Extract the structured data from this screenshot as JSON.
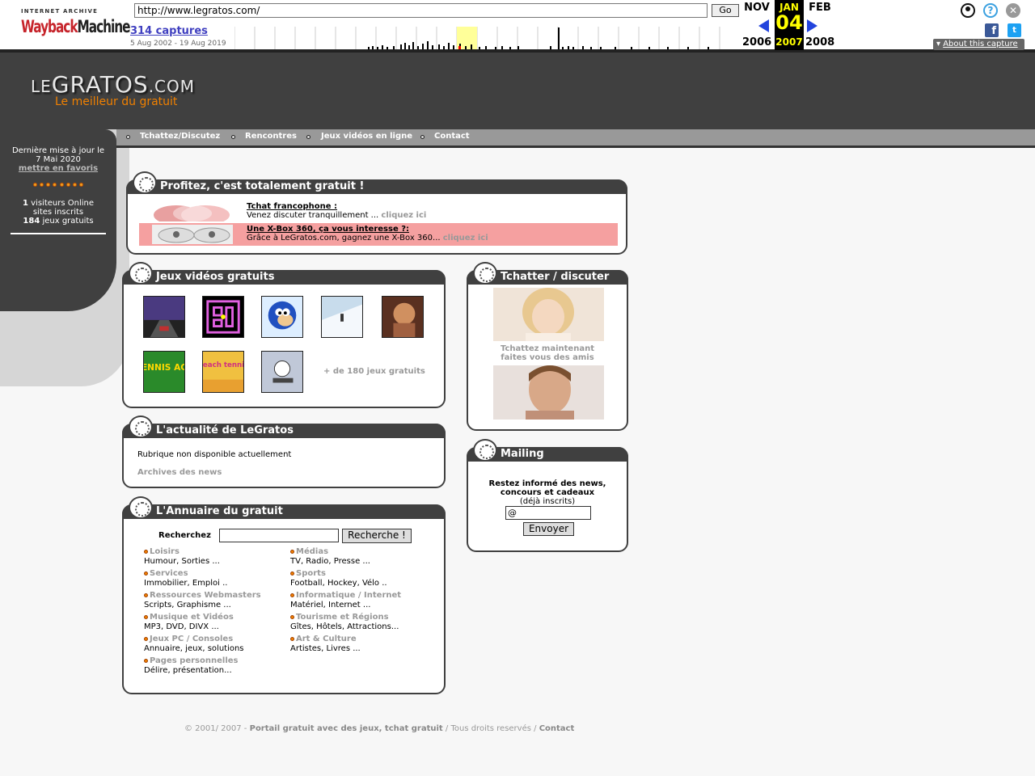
{
  "wayback": {
    "logo_top": "INTERNET ARCHIVE",
    "logo_wayback": "Wayback",
    "logo_machine": "Machine",
    "url": "http://www.legratos.com/",
    "go": "Go",
    "captures": "314 captures",
    "range": "5 Aug 2002 - 19 Aug 2019",
    "prev_month": "NOV",
    "prev_year": "2006",
    "cur_month": "JAN",
    "cur_day": "04",
    "cur_year": "2007",
    "next_month": "FEB",
    "next_year": "2008",
    "about": "About this capture",
    "icons": [
      "user-icon",
      "help-icon",
      "close-icon",
      "facebook-icon",
      "twitter-icon"
    ]
  },
  "site": {
    "logo_le": "LE",
    "logo_gratos": "GRATOS",
    "logo_com": ".COM",
    "tagline": "Le meilleur du gratuit",
    "nav": [
      "Tchattez/Discutez",
      "Rencontres",
      "Jeux vidéos en ligne",
      "Contact"
    ],
    "sidebar": {
      "update_line1": "Dernière mise à jour le",
      "update_date": "7 Mai 2020",
      "favorites": "mettre en favoris",
      "visitors_count": "1",
      "visitors_label": "visiteurs Online",
      "sites_label": "sites inscrits",
      "games_count": "184",
      "games_label": "jeux gratuits"
    },
    "promo": {
      "title": "Profitez, c'est totalement gratuit !",
      "item1_title": "Tchat francophone :",
      "item1_text": "Venez discuter tranquillement ...",
      "item1_link": "cliquez ici",
      "item2_title": "Une X-Box 360, ça vous interesse ?:",
      "item2_text": "Grâce à LeGratos.com, gagnez une X-Box 360...",
      "item2_link": "cliquez ici"
    },
    "games": {
      "title": "Jeux vidéos gratuits",
      "more": "+ de 180 jeux gratuits",
      "thumb_tennis": "TENNIS ACE",
      "thumb_beach": "beach tennis"
    },
    "news": {
      "title": "L'actualité de LeGratos",
      "text": "Rubrique non disponible actuellement",
      "archives": "Archives des news"
    },
    "directory": {
      "title": "L'Annuaire du gratuit",
      "search_label": "Recherchez",
      "search_button": "Recherche !",
      "categories": [
        {
          "name": "Loisirs",
          "desc": "Humour, Sorties ..."
        },
        {
          "name": "Médias",
          "desc": "TV, Radio, Presse ..."
        },
        {
          "name": "Services",
          "desc": "Immobilier, Emploi .."
        },
        {
          "name": "Sports",
          "desc": "Football, Hockey, Vélo .."
        },
        {
          "name": "Ressources Webmasters",
          "desc": "Scripts, Graphisme ..."
        },
        {
          "name": "Informatique / Internet",
          "desc": "Matériel, Internet ..."
        },
        {
          "name": "Musique et Vidéos",
          "desc": "MP3, DVD, DIVX ..."
        },
        {
          "name": "Tourisme et Régions",
          "desc": "Gîtes, Hôtels, Attractions..."
        },
        {
          "name": "Jeux PC / Consoles",
          "desc": "Annuaire, jeux, solutions"
        },
        {
          "name": "Art & Culture",
          "desc": "Artistes, Livres ..."
        },
        {
          "name": "Pages personnelles",
          "desc": "Délire, présentation..."
        }
      ]
    },
    "chat": {
      "title": "Tchatter / discuter",
      "line1": "Tchattez maintenant",
      "line2": "faites vous des amis"
    },
    "mailing": {
      "title": "Mailing",
      "line1": "Restez informé des news,",
      "line2": "concours et cadeaux",
      "line3": "(déjà inscrits)",
      "email_value": "@",
      "submit": "Envoyer"
    },
    "footer": {
      "copy": "© 2001/ 2007 -",
      "link1": "Portail gratuit avec des jeux, tchat gratuit",
      "mid": "/ Tous droits reservés /",
      "link2": "Contact"
    }
  }
}
